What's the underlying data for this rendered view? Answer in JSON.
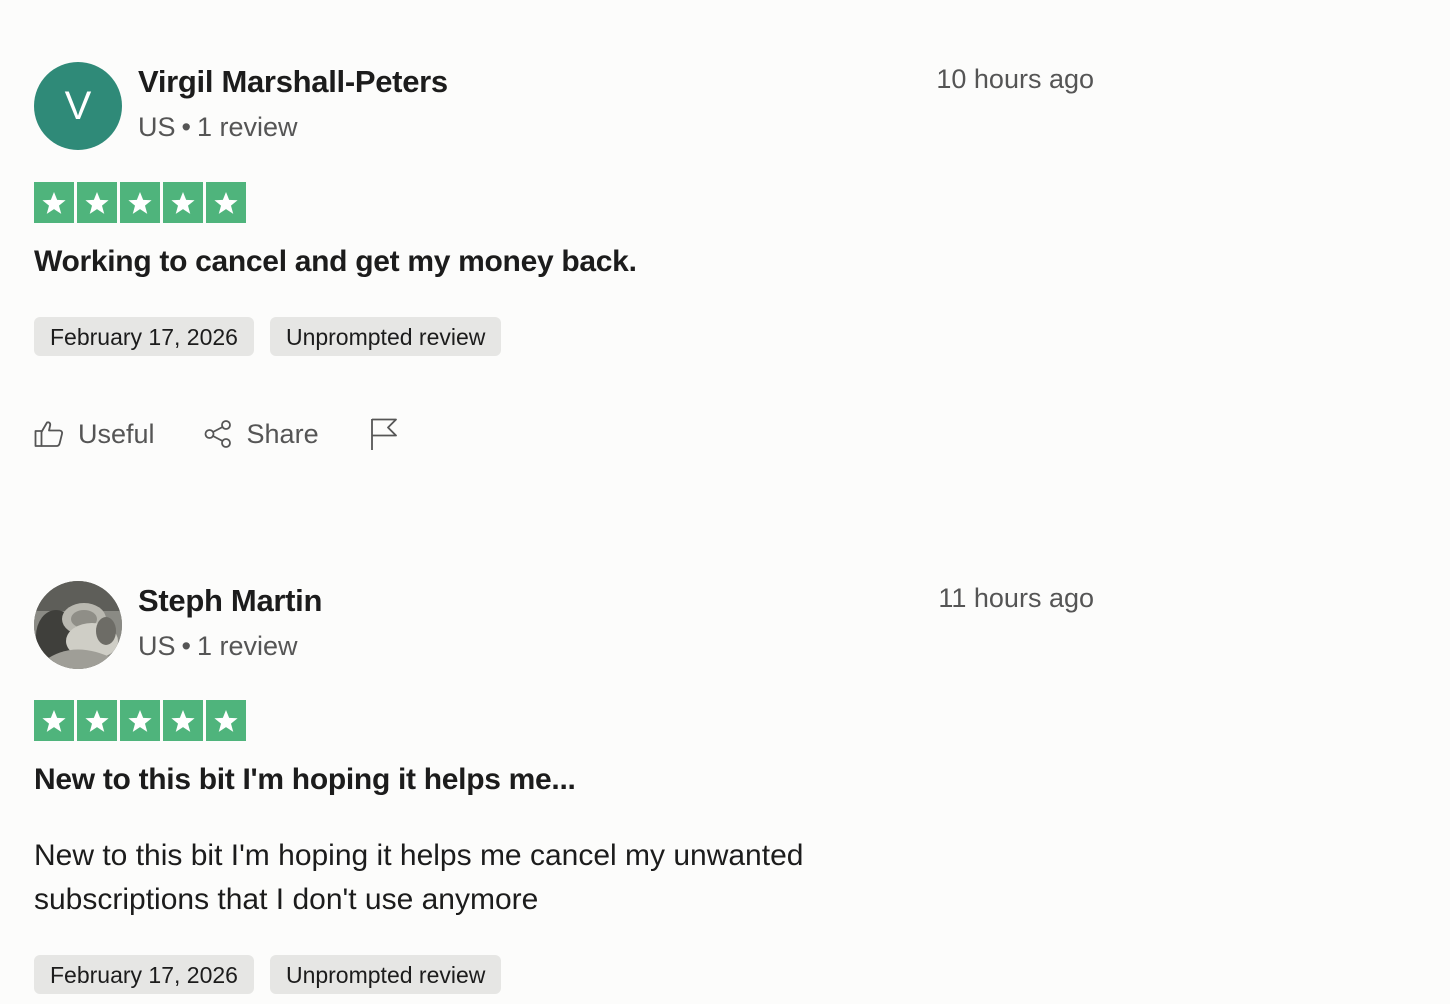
{
  "reviews": [
    {
      "reviewer": {
        "name": "Virgil Marshall-Peters",
        "avatar_initial": "V",
        "country": "US",
        "review_count": "1 review"
      },
      "time_ago": "10 hours ago",
      "rating": 5,
      "title": "Working to cancel and get my money back.",
      "body": "",
      "tags": {
        "date": "February 17, 2026",
        "type": "Unprompted review"
      },
      "actions": {
        "useful_label": "Useful",
        "share_label": "Share",
        "flag_icon": "flag-icon"
      }
    },
    {
      "reviewer": {
        "name": "Steph Martin",
        "avatar_icon": "profile-photo",
        "country": "US",
        "review_count": "1 review"
      },
      "time_ago": "11 hours ago",
      "rating": 5,
      "title": "New to this bit I'm hoping it helps me...",
      "body": "New to this bit I'm hoping it helps me cancel my unwanted subscriptions that I don't use anymore",
      "tags": {
        "date": "February 17, 2026",
        "type": "Unprompted review"
      }
    }
  ],
  "colors": {
    "star_green": "#4fb47c",
    "avatar_teal": "#2f8a78",
    "tag_background": "#e6e6e4"
  }
}
